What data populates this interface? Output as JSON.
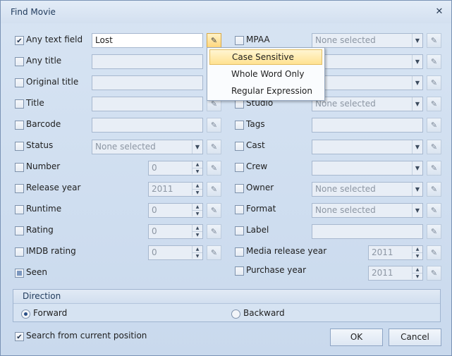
{
  "window": {
    "title": "Find Movie",
    "close_glyph": "✕"
  },
  "left_fields": [
    {
      "label": "Any text field",
      "checked": true,
      "value": "Lost"
    },
    {
      "label": "Any title",
      "checked": false,
      "value": ""
    },
    {
      "label": "Original title",
      "checked": false,
      "value": ""
    },
    {
      "label": "Title",
      "checked": false,
      "value": ""
    },
    {
      "label": "Barcode",
      "checked": false,
      "value": ""
    },
    {
      "label": "Status",
      "checked": false,
      "value": "None selected"
    },
    {
      "label": "Number",
      "checked": false,
      "value": "0"
    },
    {
      "label": "Release year",
      "checked": false,
      "value": "2011"
    },
    {
      "label": "Runtime",
      "checked": false,
      "value": "0"
    },
    {
      "label": "Rating",
      "checked": false,
      "value": "0"
    },
    {
      "label": "IMDB rating",
      "checked": false,
      "value": "0"
    },
    {
      "label": "Seen",
      "checked": false,
      "indeterminate": true
    }
  ],
  "right_fields": [
    {
      "label": "MPAA",
      "checked": false,
      "value": "None selected"
    },
    {
      "label": "Studio",
      "checked": false,
      "value": "None selected"
    },
    {
      "label": "Tags",
      "checked": false,
      "value": ""
    },
    {
      "label": "Cast",
      "checked": false,
      "value": ""
    },
    {
      "label": "Crew",
      "checked": false,
      "value": ""
    },
    {
      "label": "Owner",
      "checked": false,
      "value": "None selected"
    },
    {
      "label": "Format",
      "checked": false,
      "value": "None selected"
    },
    {
      "label": "Label",
      "checked": false,
      "value": ""
    },
    {
      "label": "Media release year",
      "checked": false,
      "value": "2011"
    },
    {
      "label": "Purchase year",
      "checked": false,
      "value": "2011"
    }
  ],
  "options_menu": {
    "items": [
      "Case Sensitive",
      "Whole Word Only",
      "Regular Expression"
    ],
    "highlighted_index": 0
  },
  "direction": {
    "title": "Direction",
    "options": [
      "Forward",
      "Backward"
    ],
    "selected": "Forward"
  },
  "search_from_current": {
    "label": "Search from current position",
    "checked": true
  },
  "buttons": {
    "ok": "OK",
    "cancel": "Cancel"
  },
  "icons": {
    "options_button": "search-options-icon"
  },
  "colors": {
    "highlight_bg": "#ffe291",
    "highlight_border": "#e3be63",
    "window_bg": "#ccdbee"
  }
}
